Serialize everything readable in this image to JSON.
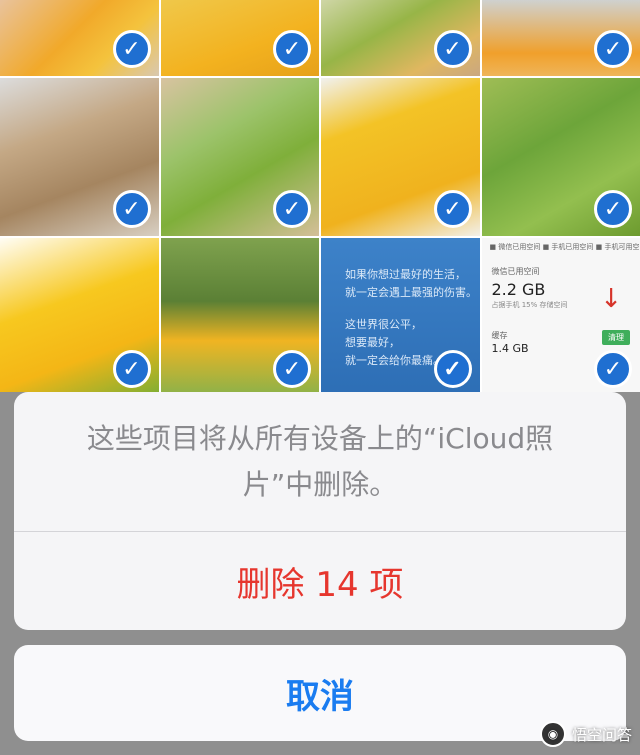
{
  "photos": {
    "check_glyph": "✓",
    "check_color": "#1f6fd1",
    "items": [
      {
        "name": "mango-in-hand"
      },
      {
        "name": "sliced-mango"
      },
      {
        "name": "green-mango-hand"
      },
      {
        "name": "mango-on-plate"
      },
      {
        "name": "mango-box-small"
      },
      {
        "name": "mango-box-green"
      },
      {
        "name": "cut-mango-closeup"
      },
      {
        "name": "green-mango-pile"
      },
      {
        "name": "yellow-mangoes"
      },
      {
        "name": "mango-tree-farmer"
      },
      {
        "name": "poem-screenshot"
      },
      {
        "name": "storage-screenshot"
      }
    ]
  },
  "poem": {
    "line1": "如果你想过最好的生活，",
    "line2": "就一定会遇上最强的伤害。",
    "line3": "这世界很公平，",
    "line4": "想要最好，",
    "line5": "就一定会给你最痛。"
  },
  "storage": {
    "legend": "■ 微信已用空间  ■ 手机已用空间  ■ 手机可用空间",
    "used_caption": "微信已用空间",
    "used_value": "2.2 GB",
    "used_sub": "占据手机 15% 存储空间",
    "cache_label": "缓存",
    "cache_value": "1.4 GB",
    "clear_label": "清理"
  },
  "dialog": {
    "message": "这些项目将从所有设备上的“iCloud照片”中删除。",
    "delete_label": "删除 14 项",
    "cancel_label": "取消",
    "delete_color": "#e6362e",
    "cancel_color": "#1a7cf0"
  },
  "watermark": {
    "text": "悟空问答"
  }
}
